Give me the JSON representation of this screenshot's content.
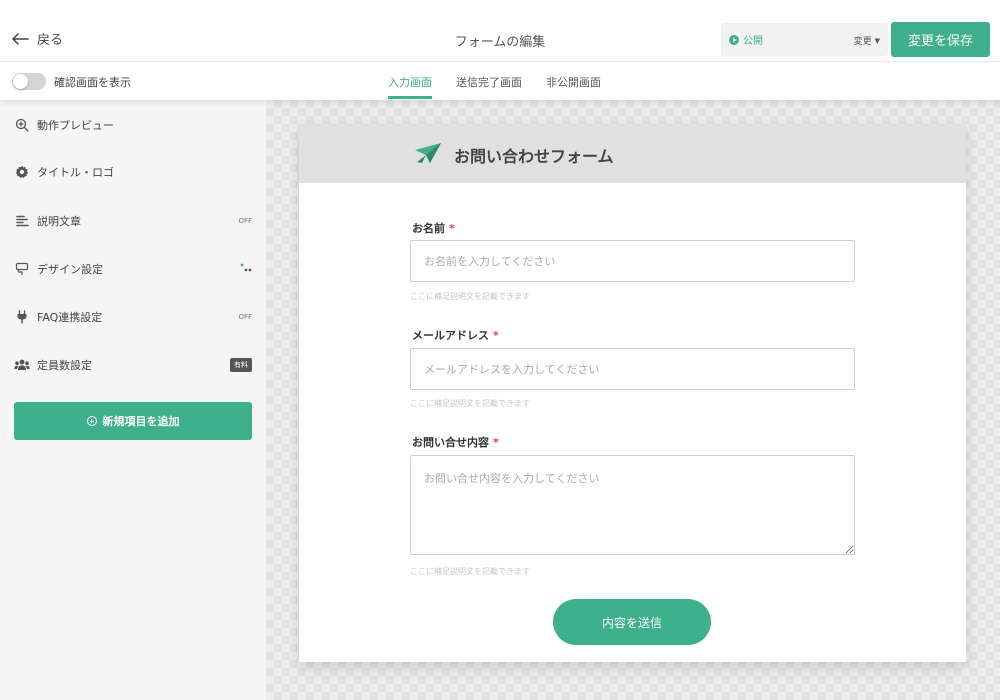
{
  "header": {
    "back_label": "戻る",
    "page_title": "フォームの編集",
    "status_label": "公開",
    "status_change_label": "変更",
    "save_label": "変更を保存"
  },
  "subbar": {
    "toggle_label": "確認画面を表示",
    "toggle_on": false,
    "tabs": [
      {
        "label": "入力画面",
        "active": true
      },
      {
        "label": "送信完了画面",
        "active": false
      },
      {
        "label": "非公開画面",
        "active": false
      }
    ]
  },
  "sidebar": {
    "items": [
      {
        "label": "動作プレビュー",
        "icon": "zoom-in-icon",
        "badge": ""
      },
      {
        "label": "タイトル・ロゴ",
        "icon": "gear-icon",
        "badge": ""
      },
      {
        "label": "説明文章",
        "icon": "text-align-icon",
        "badge": "OFF"
      },
      {
        "label": "デザイン設定",
        "icon": "palette-icon",
        "badge": ""
      },
      {
        "label": "FAQ連携設定",
        "icon": "plug-icon",
        "badge": "OFF"
      },
      {
        "label": "定員数設定",
        "icon": "users-icon",
        "badge": "有料"
      }
    ],
    "add_label": "新規項目を追加"
  },
  "form": {
    "title": "お問い合わせフォーム",
    "fields": [
      {
        "label": "お名前",
        "required": "*",
        "placeholder": "お名前を入力してください",
        "help": "ここに補足説明文を記載できます"
      },
      {
        "label": "メールアドレス",
        "required": "*",
        "placeholder": "メールアドレスを入力してください",
        "help": "ここに補足説明文を記載できます"
      },
      {
        "label": "お問い合せ内容",
        "required": "*",
        "placeholder": "お問い合せ内容を入力してください",
        "help": "ここに補足説明文を記載できます"
      }
    ],
    "submit_label": "内容を送信"
  },
  "colors": {
    "accent": "#3eb08b",
    "required": "#e0405a"
  }
}
